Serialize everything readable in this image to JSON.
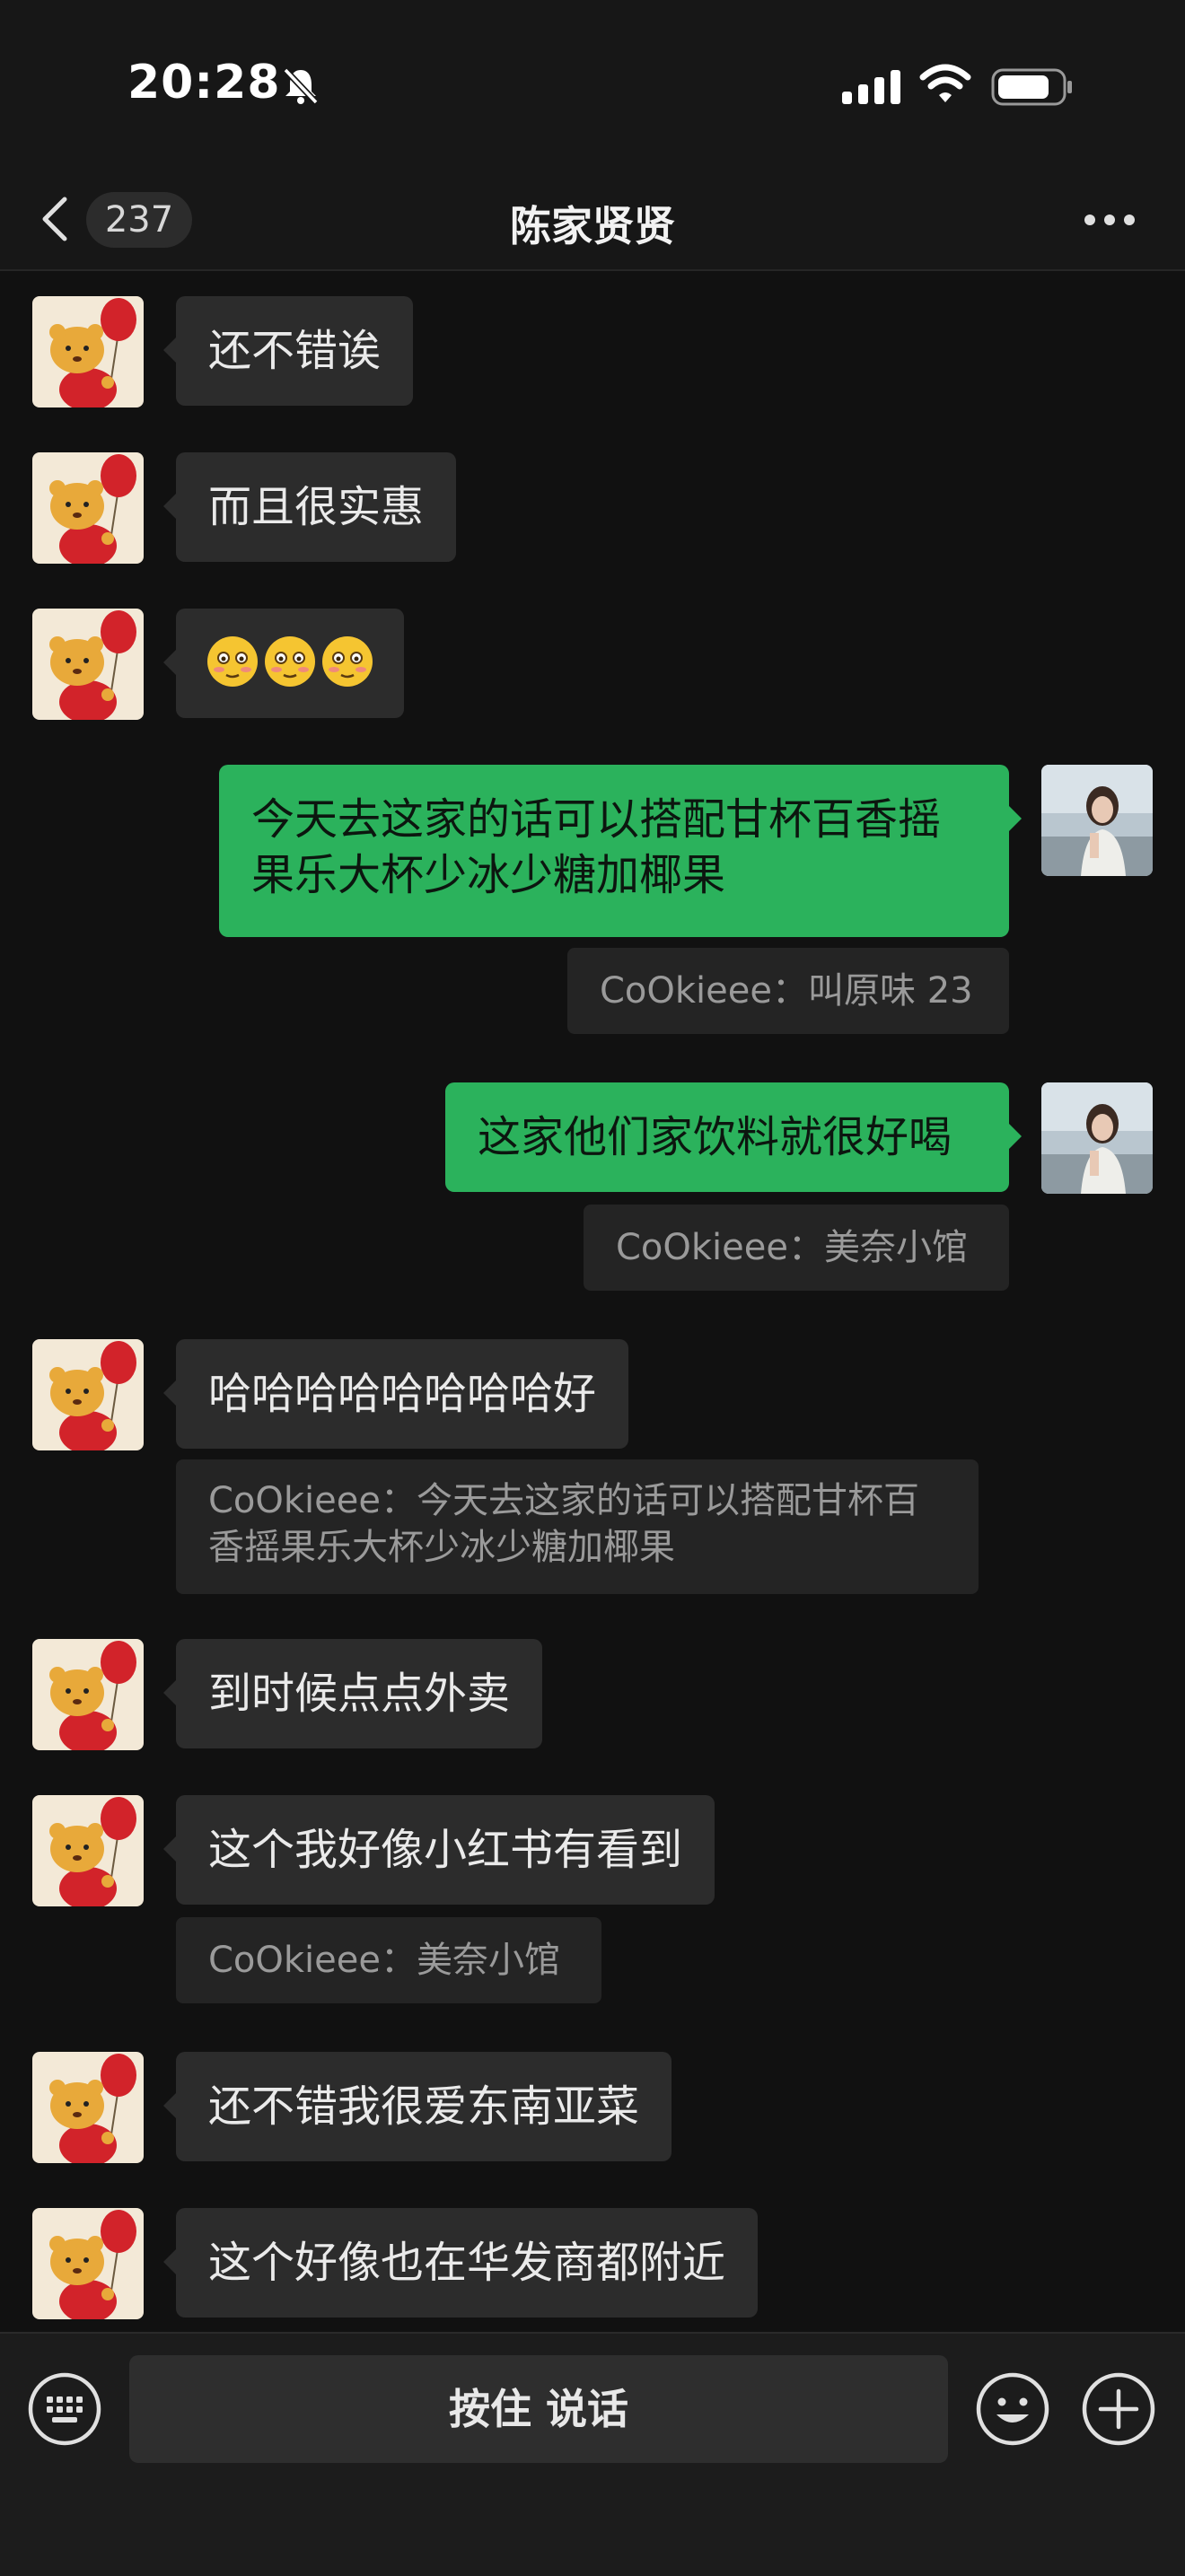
{
  "status_bar": {
    "time": "20:28"
  },
  "nav": {
    "unread_count": "237",
    "title": "陈家贤贤"
  },
  "messages": [
    {
      "side": "left",
      "text": "还不错诶"
    },
    {
      "side": "left",
      "text": "而且很实惠"
    },
    {
      "side": "left",
      "text": "",
      "emoji": "😳😳😳"
    },
    {
      "side": "right",
      "lines": [
        "今天去这家的话可以搭配甘杯百香摇",
        "果乐大杯少冰少糖加椰果"
      ]
    },
    {
      "side": "right",
      "quote": "CoOkieee：叫原味 23"
    },
    {
      "side": "right",
      "text": "这家他们家饮料就很好喝"
    },
    {
      "side": "right",
      "quote": "CoOkieee：美奈小馆"
    },
    {
      "side": "left",
      "text": "哈哈哈哈哈哈哈哈好"
    },
    {
      "side": "left",
      "quote_lines": [
        "CoOkieee：今天去这家的话可以搭配甘杯百",
        "香摇果乐大杯少冰少糖加椰果"
      ]
    },
    {
      "side": "left",
      "text": "到时候点点外卖"
    },
    {
      "side": "left",
      "text": "这个我好像小红书有看到"
    },
    {
      "side": "left",
      "quote": "CoOkieee：美奈小馆"
    },
    {
      "side": "left",
      "text": "还不错我很爱东南亚菜"
    },
    {
      "side": "left",
      "text": "这个好像也在华发商都附近"
    }
  ],
  "input_bar": {
    "voice_label": "按住 说话"
  },
  "colors": {
    "bubble_right": "#2bb25c",
    "bubble_left": "#2c2c2c",
    "background": "#111111"
  }
}
